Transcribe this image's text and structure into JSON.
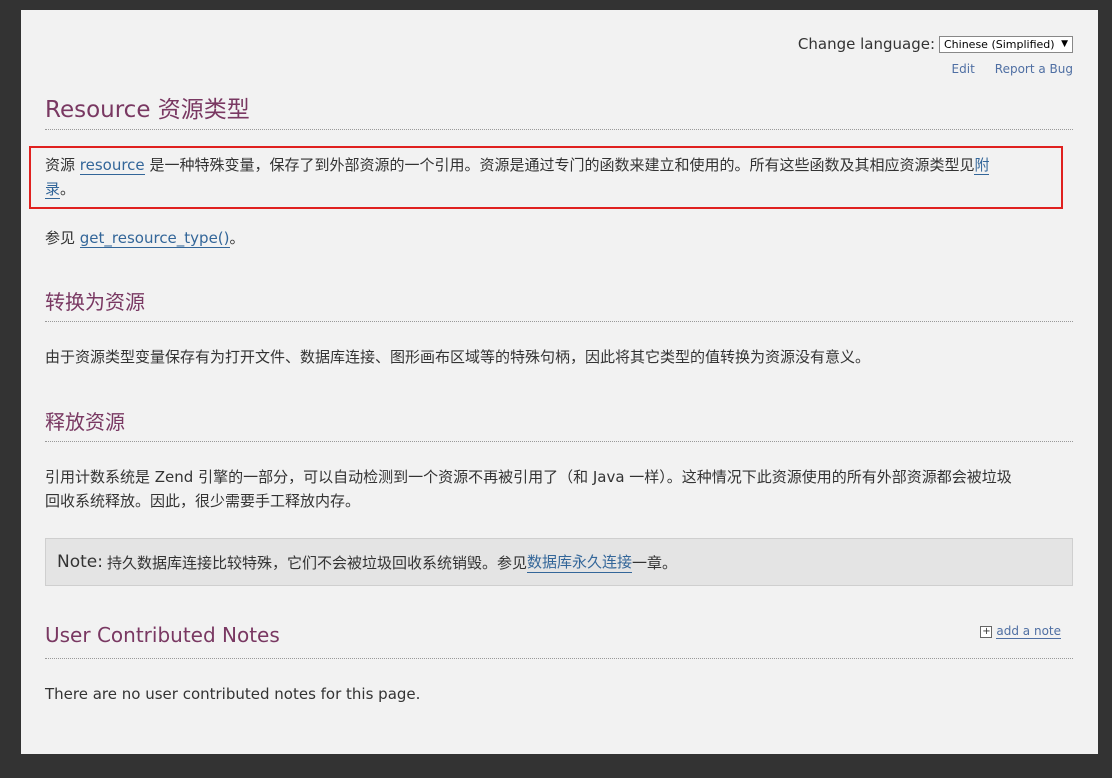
{
  "header": {
    "change_language_label": "Change language:",
    "language_selected": "Chinese (Simplified)",
    "edit_link": "Edit",
    "report_bug_link": "Report a Bug"
  },
  "title": "Resource 资源类型",
  "intro": {
    "prefix": "资源 ",
    "link_resource": "resource",
    "middle": " 是一种特殊变量，保存了到外部资源的一个引用。资源是通过专门的函数来建立和使用的。所有这些函数及其相应资源类型见",
    "link_appendix_1": "附",
    "link_appendix_2": "录",
    "suffix": "。"
  },
  "see_also": {
    "prefix": "参见 ",
    "link": "get_resource_type()",
    "suffix": "。"
  },
  "section_convert": {
    "heading": "转换为资源",
    "text": "由于资源类型变量保存有为打开文件、数据库连接、图形画布区域等的特殊句柄，因此将其它类型的值转换为资源没有意义。"
  },
  "section_free": {
    "heading": "释放资源",
    "text_line1": "引用计数系统是 Zend 引擎的一部分，可以自动检测到一个资源不再被引用了（和 Java 一样）。这种情况下此资源使用的所有外部资源都会被垃圾",
    "text_line2": "回收系统释放。因此，很少需要手工释放内存。"
  },
  "note": {
    "label": "Note:",
    "text": " 持久数据库连接比较特殊，它们不会被垃圾回收系统销毁。参见",
    "link": "数据库永久连接",
    "suffix": "一章。"
  },
  "user_notes": {
    "heading": "User Contributed Notes",
    "add_note": "add a note",
    "empty_text": "There are no user contributed notes for this page."
  },
  "colors": {
    "heading": "#793862",
    "link": "#336699",
    "highlight_border": "#e0211f"
  }
}
